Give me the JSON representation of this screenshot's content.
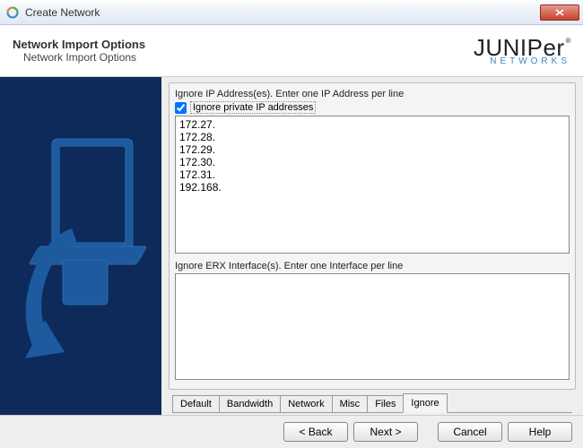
{
  "window": {
    "title": "Create Network"
  },
  "header": {
    "title": "Network Import Options",
    "subtitle": "Network Import Options",
    "logo_main": "JUNIPer",
    "logo_sub": "NETWORKS"
  },
  "panel": {
    "ip_label": "Ignore IP Address(es). Enter one IP Address per line",
    "ignore_private_checkbox_label": "Ignore private IP addresses",
    "ignore_private_checked": true,
    "ip_list": "172.27.\n172.28.\n172.29.\n172.30.\n172.31.\n192.168.",
    "erx_label": "Ignore ERX Interface(s). Enter one Interface per line",
    "erx_list": ""
  },
  "tabs": [
    {
      "label": "Default",
      "active": false
    },
    {
      "label": "Bandwidth",
      "active": false
    },
    {
      "label": "Network",
      "active": false
    },
    {
      "label": "Misc",
      "active": false
    },
    {
      "label": "Files",
      "active": false
    },
    {
      "label": "Ignore",
      "active": true
    }
  ],
  "buttons": {
    "back": "< Back",
    "next": "Next >",
    "cancel": "Cancel",
    "help": "Help"
  }
}
